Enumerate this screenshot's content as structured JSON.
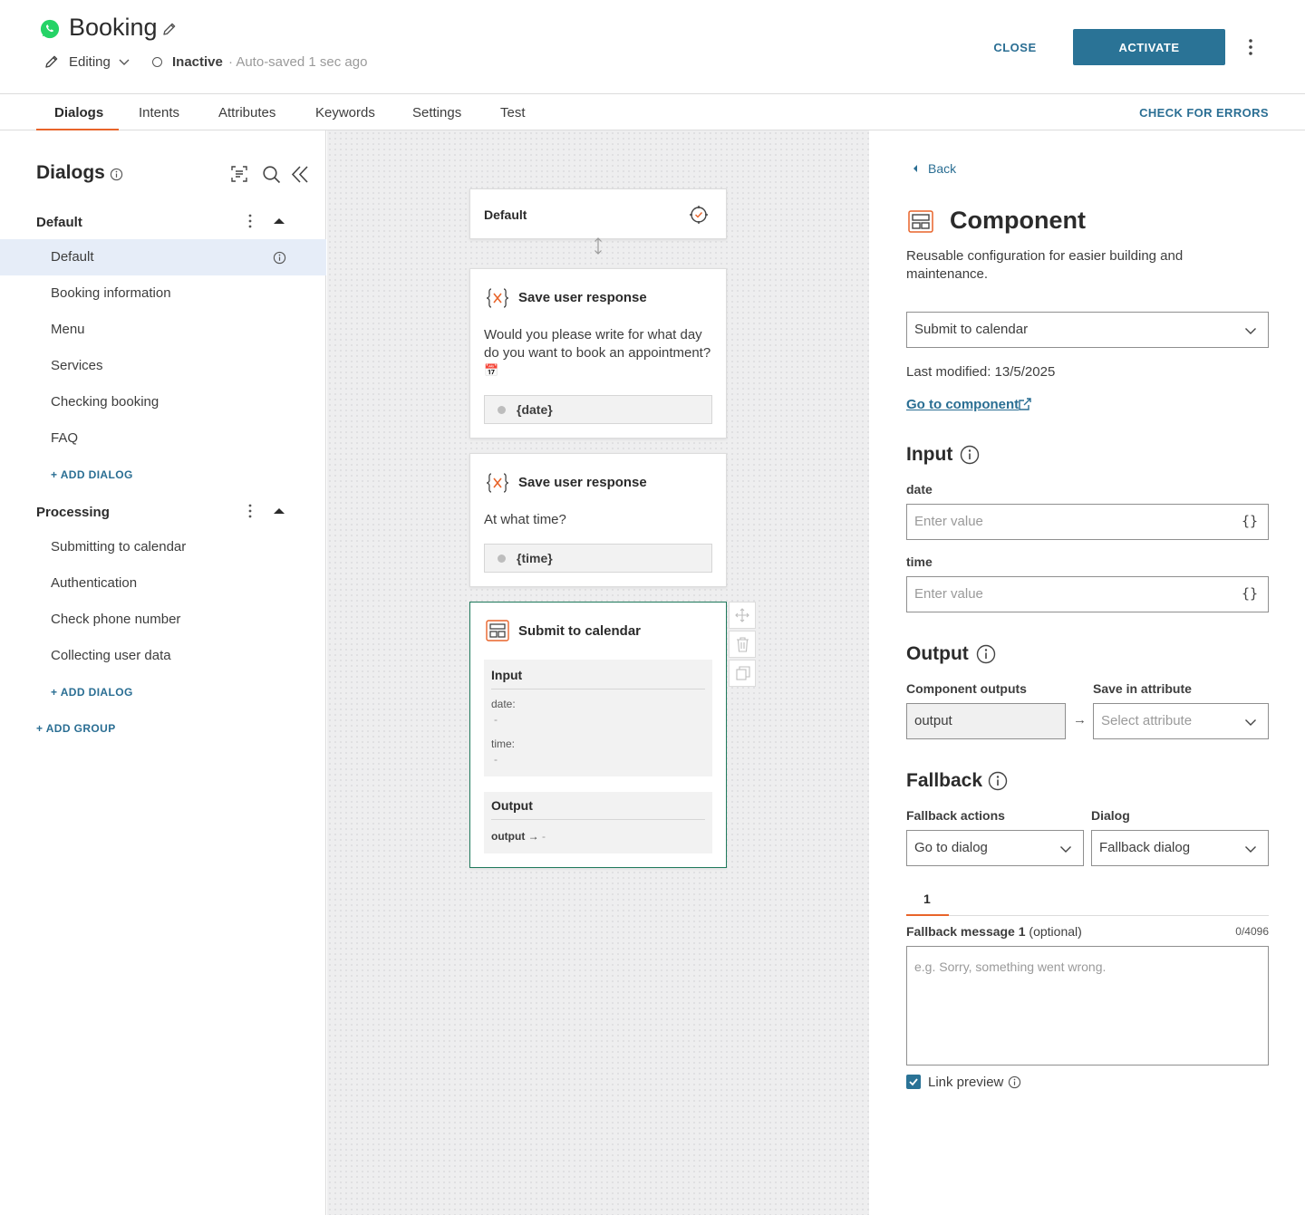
{
  "header": {
    "title": "Booking",
    "mode": "Editing",
    "status": "Inactive",
    "autosave": "· Auto-saved 1 sec ago",
    "close_label": "CLOSE",
    "activate_label": "ACTIVATE"
  },
  "tabs": [
    {
      "label": "Dialogs",
      "active": true
    },
    {
      "label": "Intents"
    },
    {
      "label": "Attributes"
    },
    {
      "label": "Keywords"
    },
    {
      "label": "Settings"
    },
    {
      "label": "Test"
    }
  ],
  "check_errors_label": "CHECK FOR ERRORS",
  "sidebar": {
    "title": "Dialogs",
    "groups": [
      {
        "name": "Default",
        "items": [
          "Default",
          "Booking information",
          "Menu",
          "Services",
          "Checking booking",
          "FAQ"
        ],
        "add_label": "+ ADD DIALOG"
      },
      {
        "name": "Processing",
        "items": [
          "Submitting to calendar",
          "Authentication",
          "Check phone number",
          "Collecting user data"
        ],
        "add_label": "+ ADD DIALOG"
      }
    ],
    "add_group_label": "+ ADD GROUP",
    "selected_item": "Default"
  },
  "canvas": {
    "start_node": {
      "title": "Default"
    },
    "nodes": [
      {
        "title": "Save user response",
        "text_line1": "Would you please write for what day",
        "text_line2": "do you want to book an appointment?",
        "emoji": "📅",
        "variable": "{date}"
      },
      {
        "title": "Save user response",
        "text_line1": "At what time?",
        "variable": "{time}"
      }
    ],
    "component_node": {
      "title": "Submit to calendar",
      "input_title": "Input",
      "inputs": [
        {
          "name": "date:",
          "value": "-"
        },
        {
          "name": "time:",
          "value": "-"
        }
      ],
      "output_title": "Output",
      "output_name": "output",
      "output_arrow": "→",
      "output_value": "-"
    }
  },
  "panel": {
    "back_label": "Back",
    "title": "Component",
    "description_line1": "Reusable configuration for easier building and",
    "description_line2": "maintenance.",
    "component_select": "Submit to calendar",
    "last_modified": "Last modified: 13/5/2025",
    "go_to_component": "Go to component",
    "input_heading": "Input",
    "inputs": [
      {
        "label": "date",
        "placeholder": "Enter value",
        "icon": "{}"
      },
      {
        "label": "time",
        "placeholder": "Enter value",
        "icon": "{}"
      }
    ],
    "output_heading": "Output",
    "component_outputs_label": "Component outputs",
    "save_in_attribute_label": "Save in attribute",
    "output_value": "output",
    "output_arrow": "→",
    "select_attribute_placeholder": "Select attribute",
    "fallback_heading": "Fallback",
    "fallback_actions_label": "Fallback actions",
    "dialog_label": "Dialog",
    "fallback_action_value": "Go to dialog",
    "dialog_value": "Fallback dialog",
    "message_tab": "1",
    "fallback_message_label": "Fallback message 1",
    "fallback_message_optional": "(optional)",
    "char_count": "0/4096",
    "fallback_placeholder": "e.g. Sorry, something went wrong.",
    "link_preview_label": "Link preview",
    "link_preview_checked": true
  },
  "colors": {
    "accent": "#e8642a",
    "primary": "#2a7396",
    "link": "#2a6e93",
    "whatsapp": "#25d366",
    "component_border": "#1f7a5c"
  }
}
